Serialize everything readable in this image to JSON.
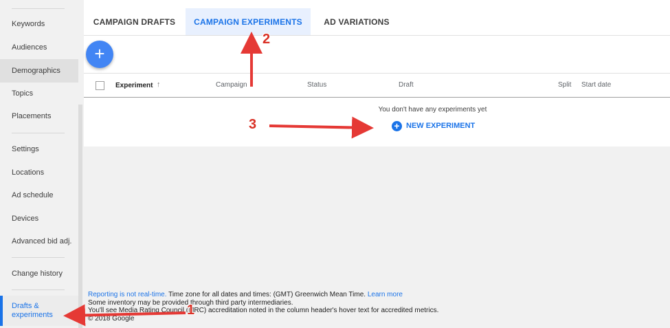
{
  "sidebar": {
    "items": [
      {
        "label": "Keywords"
      },
      {
        "label": "Audiences"
      },
      {
        "label": "Demographics"
      },
      {
        "label": "Topics"
      },
      {
        "label": "Placements"
      },
      {
        "label": "Settings"
      },
      {
        "label": "Locations"
      },
      {
        "label": "Ad schedule"
      },
      {
        "label": "Devices"
      },
      {
        "label": "Advanced bid adj."
      },
      {
        "label": "Change history"
      },
      {
        "label": "Drafts & experiments"
      }
    ]
  },
  "tabs": [
    {
      "label": "CAMPAIGN DRAFTS"
    },
    {
      "label": "CAMPAIGN EXPERIMENTS"
    },
    {
      "label": "AD VARIATIONS"
    }
  ],
  "fab": {
    "icon": "plus-icon",
    "glyph": "+"
  },
  "table": {
    "columns": [
      "Experiment",
      "Campaign",
      "Status",
      "Draft",
      "Split",
      "Start date"
    ],
    "sort_icon": "↑"
  },
  "empty_state": {
    "message": "You don't have any experiments yet",
    "new_experiment_label": "NEW EXPERIMENT",
    "plus_glyph": "+"
  },
  "footer": {
    "reporting_link": "Reporting is not real-time.",
    "timezone_text": " Time zone for all dates and times: (GMT) Greenwich Mean Time. ",
    "learn_more": "Learn more",
    "line2": "Some inventory may be provided through third party intermediaries.",
    "line3": "You'll see Media Rating Council (MRC) accreditation noted in the column header's hover text for accredited metrics.",
    "copyright": "© 2018 Google"
  },
  "annotations": {
    "one": "1",
    "two": "2",
    "three": "3",
    "color": "#d93025"
  },
  "colors": {
    "accent": "#1a73e8",
    "fab": "#4285f4"
  }
}
